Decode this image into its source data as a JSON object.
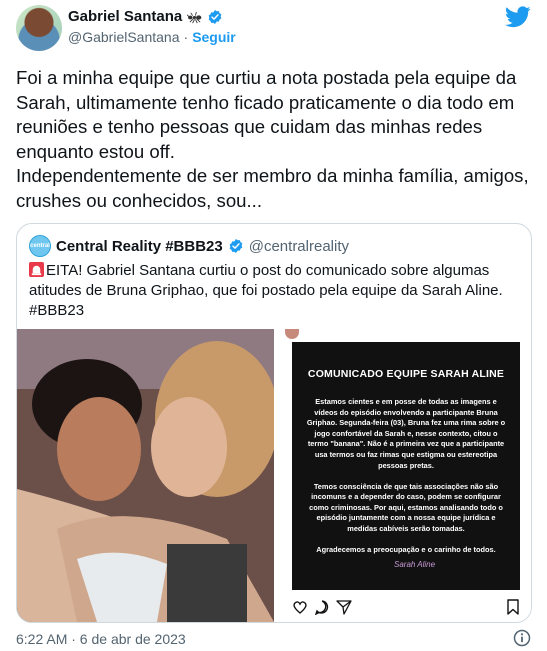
{
  "author": {
    "name": "Gabriel Santana",
    "handle": "@GabrielSantana",
    "separator": "·",
    "follow_label": "Seguir"
  },
  "tweet": {
    "paragraph1": "Foi a minha equipe que curtiu a nota postada pela equipe da Sarah, ultimamente tenho ficado praticamente o dia todo em reuniões e tenho pessoas que cuidam das minhas redes enquanto estou off.",
    "paragraph2": "Independentemente de ser membro da minha família, amigos, crushes ou conhecidos, sou..."
  },
  "quoted": {
    "name": "Central Reality #BBB23",
    "handle": "@centralreality",
    "text": "EITA! Gabriel Santana curtiu o post do comunicado sobre algumas atitudes de Bruna Griphao, que foi postado pela equipe da Sarah Aline. #BBB23",
    "avatar_text": "central"
  },
  "statement": {
    "title": "COMUNICADO EQUIPE SARAH ALINE",
    "p1": "Estamos cientes e em posse de todas as imagens e vídeos do episódio envolvendo a participante Bruna Griphao. Segunda-feira (03), Bruna fez uma rima sobre o jogo confortável da Sarah e, nesse contexto, citou o termo \"banana\". Não é a primeira vez que a participante usa termos ou faz rimas que estigma ou estereotipa pessoas pretas.",
    "p2": "Temos consciência de que tais associações não são incomuns e a depender do caso, podem se configurar como criminosas. Por aqui, estamos analisando todo o episódio juntamente com a nossa equipe jurídica e medidas cabíveis serão tomadas.",
    "p3": "Agradecemos a preocupação e o carinho de todos.",
    "logo": "Sarah Aline"
  },
  "footer": {
    "timestamp": "6:22 AM · 6 de abr de 2023"
  },
  "colors": {
    "accent": "#1d9bf0",
    "text": "#0f1419",
    "muted": "#536471",
    "border": "#cfd9de"
  },
  "icons": [
    "verified-badge-icon",
    "ant-emoji-icon",
    "twitter-bird-icon",
    "siren-emoji-icon",
    "heart-icon",
    "comment-icon",
    "share-icon",
    "bookmark-icon",
    "info-icon"
  ]
}
